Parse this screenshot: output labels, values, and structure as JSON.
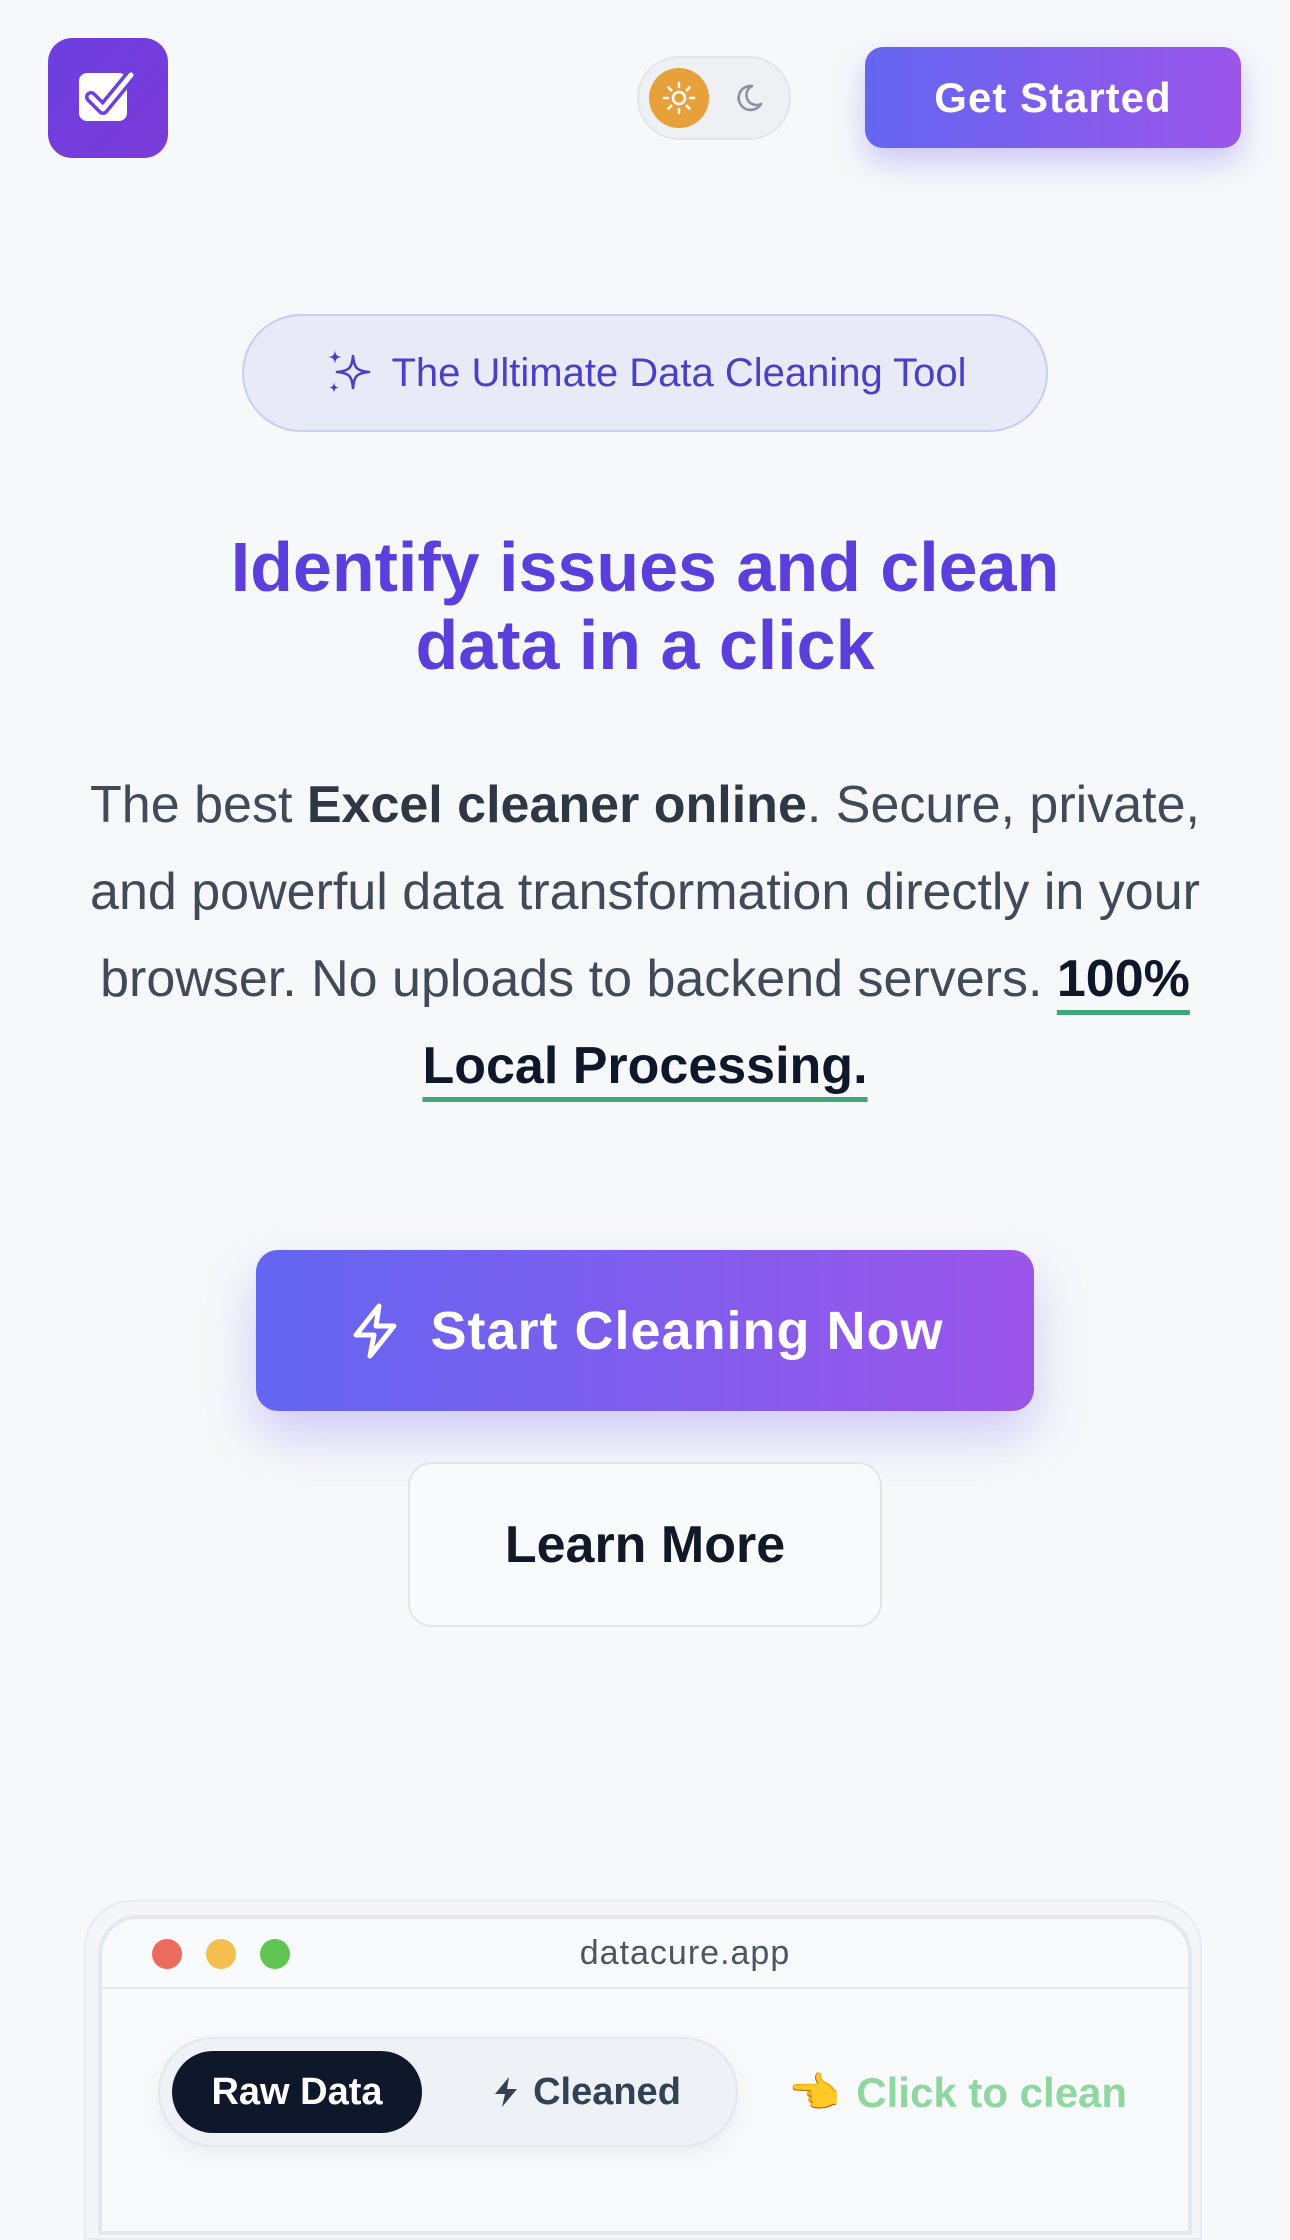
{
  "header": {
    "logo_alt": "DataCure logo",
    "get_started_label": "Get Started"
  },
  "hero": {
    "badge_text": "The Ultimate Data Cleaning Tool",
    "headline_line1": "Identify issues and clean",
    "headline_line2": "data in a click",
    "intro_part1": "The best ",
    "intro_bold": "Excel cleaner online",
    "intro_part2": ". Secure, private, and powerful data transformation directly in your browser. No uploads to backend servers. ",
    "intro_highlight": "100% Local Processing.",
    "primary_cta": "Start Cleaning Now",
    "secondary_cta": "Learn More"
  },
  "preview": {
    "url": "datacure.app",
    "tab_raw": "Raw Data",
    "tab_cleaned": "Cleaned",
    "hint_icon": "👈",
    "hint_text": "Click to clean"
  },
  "colors": {
    "brand_purple": "#5b3fdc",
    "gradient_start": "#6366f1",
    "gradient_end": "#9b55ea",
    "underline_green": "#3fa77a",
    "hint_green": "#8ed79f",
    "sun_orange": "#e8a03a"
  }
}
